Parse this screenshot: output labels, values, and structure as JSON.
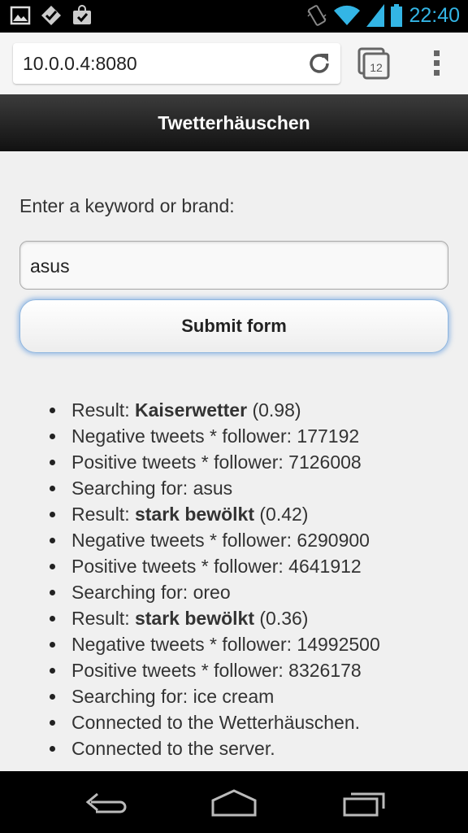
{
  "status_bar": {
    "time": "22:40",
    "left_icons": [
      "gallery-icon",
      "checkmark-icon",
      "shopping-bag-icon"
    ],
    "right_icons": [
      "vibrate-icon",
      "wifi-icon",
      "signal-icon",
      "battery-icon"
    ]
  },
  "browser": {
    "url": "10.0.0.4:8080",
    "tab_count": "12"
  },
  "header": {
    "title": "Twetterhäuschen"
  },
  "form": {
    "prompt": "Enter a keyword or brand:",
    "keyword_value": "asus",
    "submit_label": "Submit form"
  },
  "log": [
    {
      "prefix": "Result: ",
      "strong": "Kaiserwetter",
      "suffix": " (0.98)"
    },
    {
      "prefix": "Negative tweets * follower: 177192",
      "strong": "",
      "suffix": ""
    },
    {
      "prefix": "Positive tweets * follower: 7126008",
      "strong": "",
      "suffix": ""
    },
    {
      "prefix": "Searching for: asus",
      "strong": "",
      "suffix": ""
    },
    {
      "prefix": "Result: ",
      "strong": "stark bewölkt",
      "suffix": " (0.42)"
    },
    {
      "prefix": "Negative tweets * follower: 6290900",
      "strong": "",
      "suffix": ""
    },
    {
      "prefix": "Positive tweets * follower: 4641912",
      "strong": "",
      "suffix": ""
    },
    {
      "prefix": "Searching for: oreo",
      "strong": "",
      "suffix": ""
    },
    {
      "prefix": "Result: ",
      "strong": "stark bewölkt",
      "suffix": " (0.36)"
    },
    {
      "prefix": "Negative tweets * follower: 14992500",
      "strong": "",
      "suffix": ""
    },
    {
      "prefix": "Positive tweets * follower: 8326178",
      "strong": "",
      "suffix": ""
    },
    {
      "prefix": "Searching for: ice cream",
      "strong": "",
      "suffix": ""
    },
    {
      "prefix": "Connected to the Wetterhäuschen.",
      "strong": "",
      "suffix": ""
    },
    {
      "prefix": "Connected to the server.",
      "strong": "",
      "suffix": ""
    }
  ],
  "nav": {
    "icons": [
      "back-icon",
      "home-icon",
      "recent-apps-icon"
    ]
  },
  "colors": {
    "status_accent": "#33b5e5",
    "header_bg": "#1a1a1a",
    "button_glow": "#5a96dc"
  }
}
